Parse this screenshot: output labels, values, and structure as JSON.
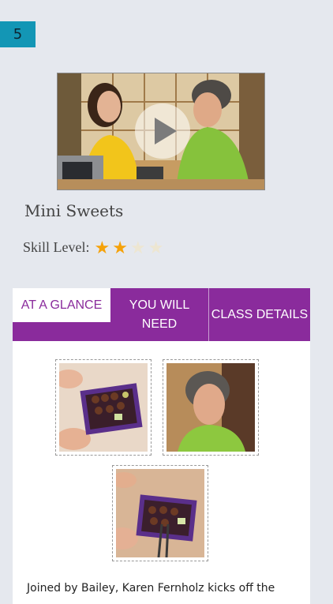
{
  "badge": {
    "number": "5"
  },
  "lesson": {
    "title": "Mini Sweets",
    "skill_label": "Skill Level:",
    "skill_rating": 2,
    "skill_max": 4
  },
  "tabs": [
    {
      "label": "AT A GLANCE",
      "active": true
    },
    {
      "label": "YOU WILL NEED",
      "active": false
    },
    {
      "label": "CLASS DETAILS",
      "active": false
    }
  ],
  "description": "Joined by Bailey, Karen Fernholz kicks off the",
  "colors": {
    "accent": "#8a2b9c",
    "badge": "#1396b5",
    "star": "#f5a20a",
    "background": "#e5e8ee"
  },
  "icons": {
    "play": "play-icon",
    "star": "star-icon"
  }
}
